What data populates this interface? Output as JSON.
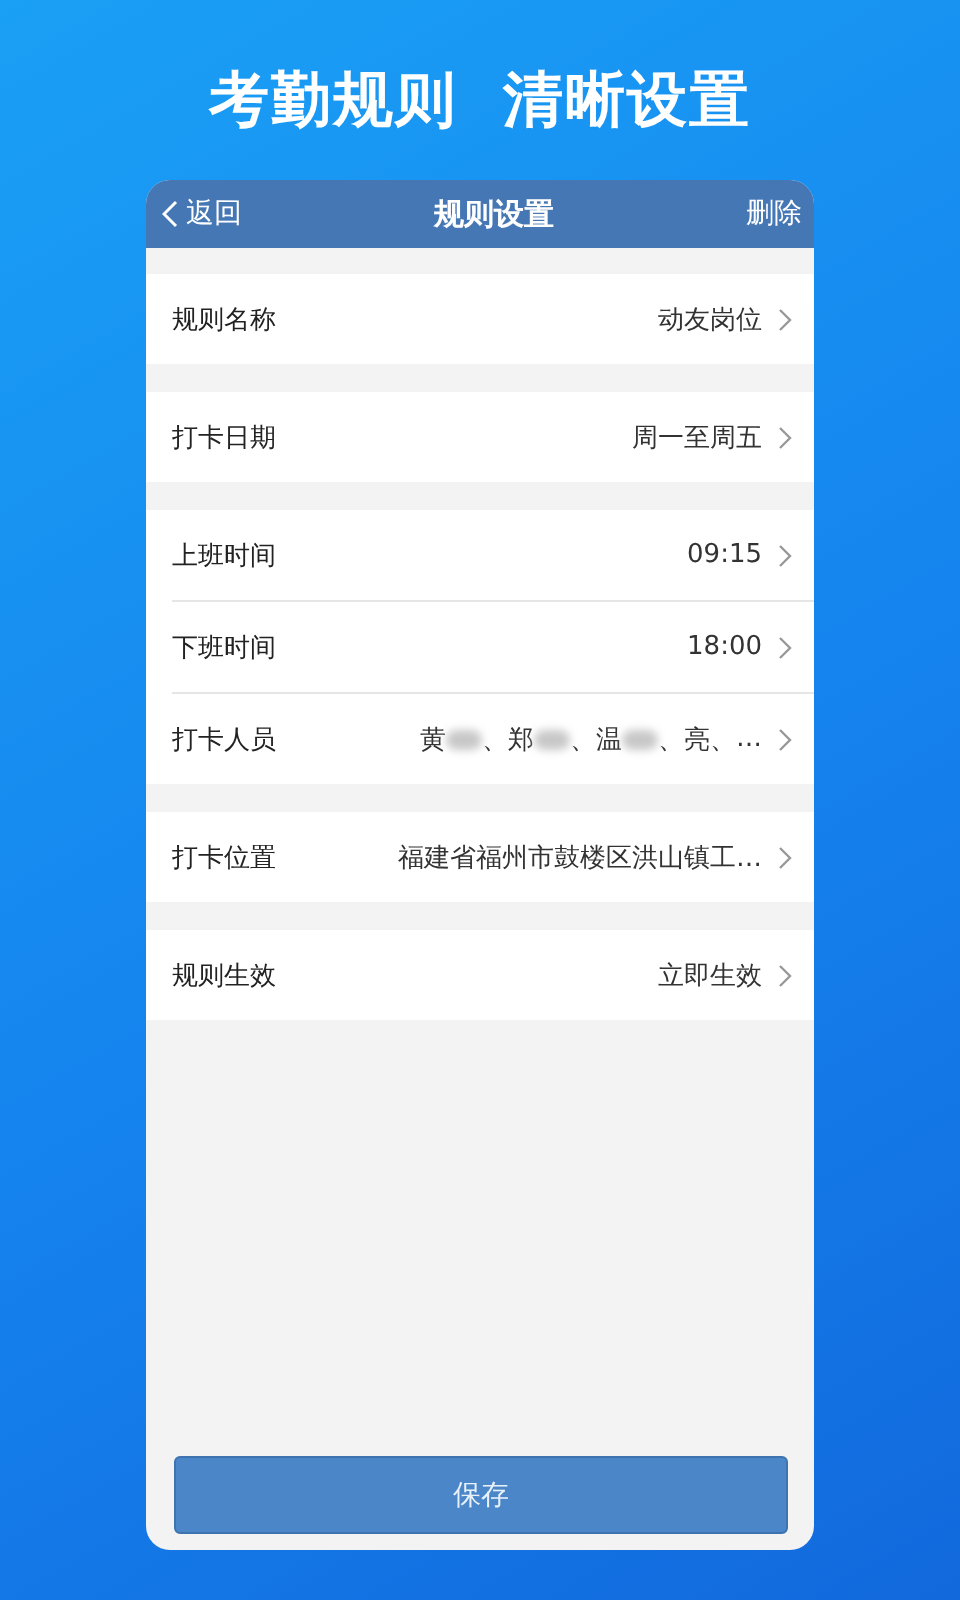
{
  "headline": "考勤规则  清晰设置",
  "nav": {
    "back": "返回",
    "title": "规则设置",
    "action": "删除"
  },
  "groups": [
    {
      "rows": [
        {
          "kind": "text",
          "label": "规则名称",
          "value": "动友岗位"
        }
      ]
    },
    {
      "rows": [
        {
          "kind": "text",
          "label": "打卡日期",
          "value": "周一至周五"
        }
      ]
    },
    {
      "rows": [
        {
          "kind": "text",
          "label": "上班时间",
          "value": "09:15"
        },
        {
          "kind": "text",
          "label": "下班时间",
          "value": "18:00"
        },
        {
          "kind": "people",
          "label": "打卡人员",
          "people": [
            {
              "name": "黄",
              "redacted": true
            },
            {
              "name": "郑",
              "redacted": true
            },
            {
              "name": "温",
              "redacted": true
            },
            {
              "name": "亮",
              "redacted": false
            }
          ],
          "separator": "、",
          "more": "…"
        }
      ]
    },
    {
      "rows": [
        {
          "kind": "text",
          "label": "打卡位置",
          "value": "福建省福州市鼓楼区洪山镇工…"
        }
      ]
    },
    {
      "rows": [
        {
          "kind": "text",
          "label": "规则生效",
          "value": "立即生效"
        }
      ]
    }
  ],
  "save_button": "保存"
}
